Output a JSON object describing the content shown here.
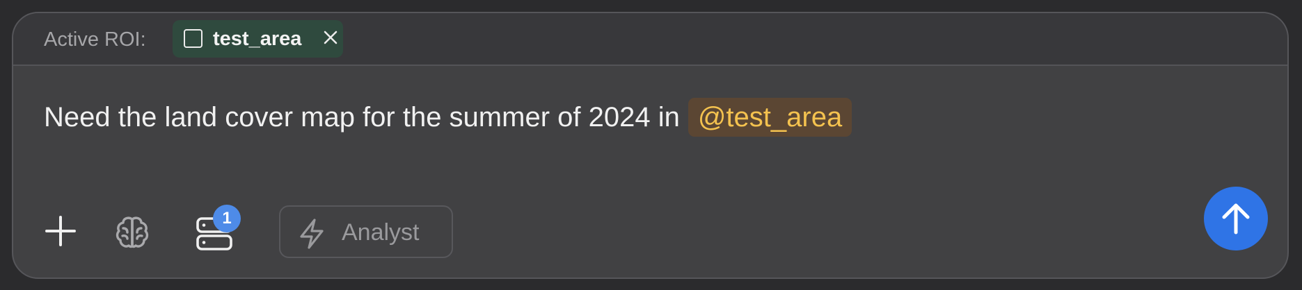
{
  "roi": {
    "label": "Active ROI:",
    "chip_name": "test_area",
    "chip_icon": "square-icon",
    "remove_icon": "close-icon"
  },
  "message": {
    "text": "Need the land cover map for the summer of 2024 in",
    "mention": "@test_area"
  },
  "toolbar": {
    "add_icon": "plus-icon",
    "brain_icon": "brain-icon",
    "datasource_icon": "database-icon",
    "datasource_count": "1",
    "mode_icon": "lightning-icon",
    "mode_label": "Analyst",
    "send_icon": "arrow-up-icon"
  },
  "colors": {
    "background": "#2b2b2d",
    "card": "#414143",
    "chip_bg": "#2f4a3e",
    "mention_bg": "#5b4633",
    "mention_text": "#f4c24f",
    "badge": "#4e8be8",
    "send_button": "#2f74e6"
  }
}
